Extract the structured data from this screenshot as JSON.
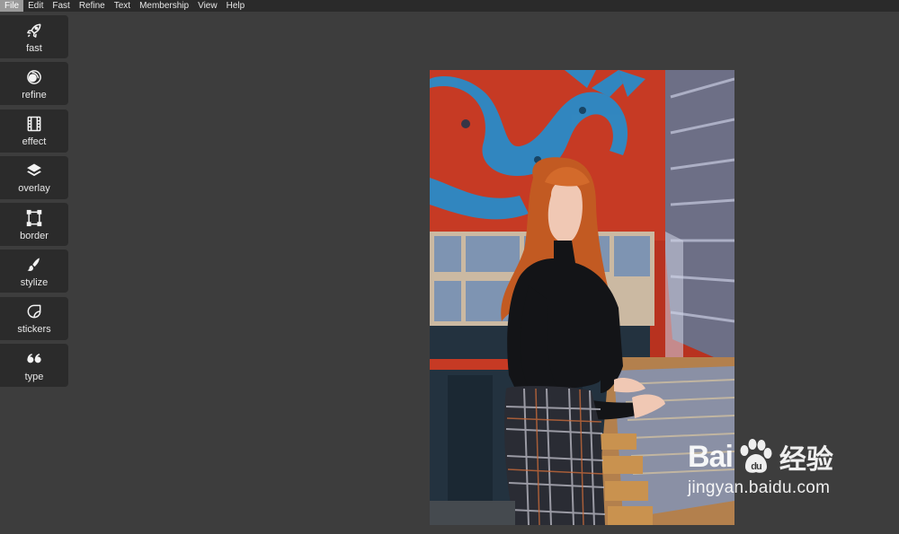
{
  "menu": {
    "items": [
      "File",
      "Edit",
      "Fast",
      "Refine",
      "Text",
      "Membership",
      "View",
      "Help"
    ],
    "active": "File"
  },
  "sidebar": {
    "tools": [
      {
        "label": "fast",
        "icon": "rocket-icon"
      },
      {
        "label": "refine",
        "icon": "refine-icon"
      },
      {
        "label": "effect",
        "icon": "film-icon"
      },
      {
        "label": "overlay",
        "icon": "layers-icon"
      },
      {
        "label": "border",
        "icon": "frame-icon"
      },
      {
        "label": "stylize",
        "icon": "brush-icon"
      },
      {
        "label": "stickers",
        "icon": "sticker-icon"
      },
      {
        "label": "type",
        "icon": "quote-icon"
      }
    ]
  },
  "watermark": {
    "logo_text_left": "Bai",
    "logo_text_right": "经验",
    "url": "jingyan.baidu.com"
  },
  "colors": {
    "background": "#3d3d3d",
    "menubar": "#2a2a2a",
    "tool_bg": "#2b2b2b",
    "menu_active": "#9a9a9a"
  }
}
